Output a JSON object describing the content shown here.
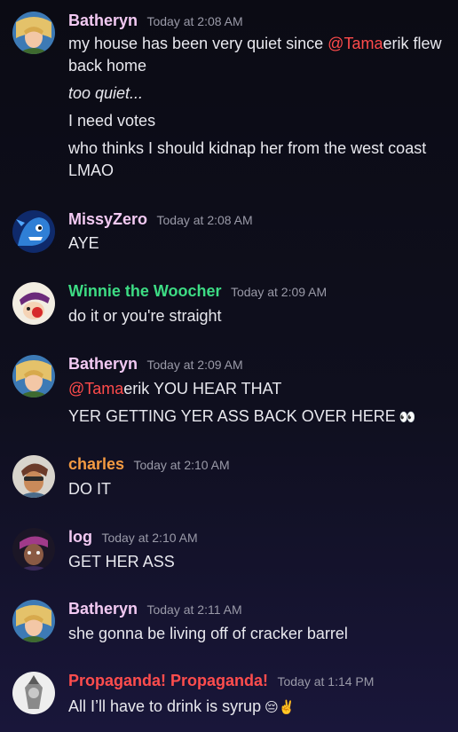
{
  "colors": {
    "batheryn": "#f2c9f2",
    "missyzero": "#f2c9f2",
    "winnie": "#3ddc84",
    "charles": "#f59b42",
    "log": "#f2c9f2",
    "propaganda": "#ff4d4d",
    "mention": "#ff4b4b"
  },
  "messages": [
    {
      "author": "Batheryn",
      "timestamp": "Today at 2:08 AM",
      "avatar_icon": "batheryn-avatar-icon",
      "lines": [
        {
          "mention": "@Tama",
          "pre": "my house has been very quiet since ",
          "post": "erik flew"
        },
        {
          "text": "back home"
        },
        {
          "text": "too quiet..."
        },
        {
          "text": "I need votes"
        },
        {
          "text": "who thinks I should kidnap her from the west coast"
        },
        {
          "text": "LMAO"
        }
      ]
    },
    {
      "author": "MissyZero",
      "timestamp": "Today at 2:08 AM",
      "avatar_icon": "missyzero-avatar-icon",
      "lines": [
        {
          "text": "AYE"
        }
      ]
    },
    {
      "author": "Winnie the Woocher",
      "timestamp": "Today at 2:09 AM",
      "avatar_icon": "winnie-avatar-icon",
      "lines": [
        {
          "text": "do it or you're straight"
        }
      ]
    },
    {
      "author": "Batheryn",
      "timestamp": "Today at 2:09 AM",
      "avatar_icon": "batheryn-avatar-icon",
      "lines": [
        {
          "mention": "@Tama",
          "post": "erik YOU HEAR THAT"
        },
        {
          "text": "YER GETTING YER ASS BACK OVER HERE",
          "emoji": "👀"
        }
      ]
    },
    {
      "author": "charles",
      "timestamp": "Today at 2:10 AM",
      "avatar_icon": "charles-avatar-icon",
      "lines": [
        {
          "text": "DO IT"
        }
      ]
    },
    {
      "author": "log",
      "timestamp": "Today at 2:10 AM",
      "avatar_icon": "log-avatar-icon",
      "lines": [
        {
          "text": "GET HER ASS"
        }
      ]
    },
    {
      "author": "Batheryn",
      "timestamp": "Today at 2:11 AM",
      "avatar_icon": "batheryn-avatar-icon",
      "lines": [
        {
          "text": "she gonna be living off of cracker barrel"
        }
      ]
    },
    {
      "author": "Propaganda! Propaganda!",
      "timestamp": "Today at 1:14 PM",
      "avatar_icon": "propaganda-avatar-icon",
      "lines": [
        {
          "text": "All I’ll have to drink is syrup",
          "emoji": "😔✌️"
        }
      ]
    }
  ]
}
